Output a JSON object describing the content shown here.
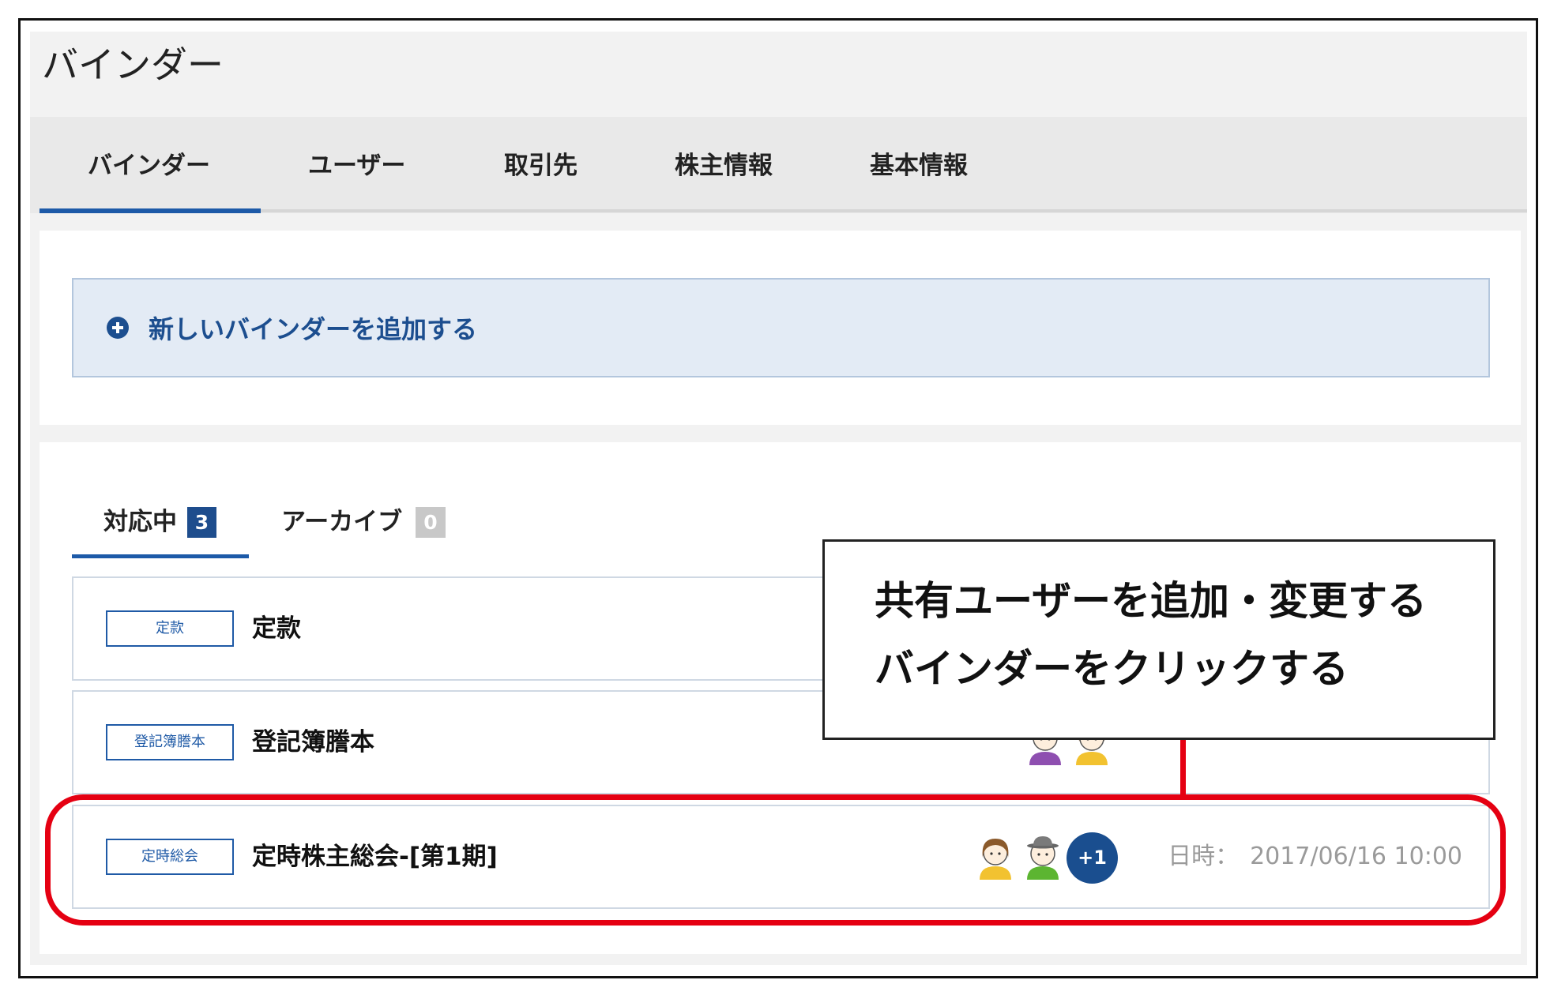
{
  "page": {
    "title": "バインダー"
  },
  "nav": {
    "tabs": [
      {
        "label": "バインダー",
        "active": true
      },
      {
        "label": "ユーザー",
        "active": false
      },
      {
        "label": "取引先",
        "active": false
      },
      {
        "label": "株主情報",
        "active": false
      },
      {
        "label": "基本情報",
        "active": false
      }
    ]
  },
  "add_binder": {
    "label": "新しいバインダーを追加する",
    "icon": "plus-circle-icon"
  },
  "binder_tabs": [
    {
      "label": "対応中",
      "count": "3",
      "active": true
    },
    {
      "label": "アーカイブ",
      "count": "0",
      "active": false
    }
  ],
  "binders": [
    {
      "tag": "定款",
      "title": "定款"
    },
    {
      "tag": "登記簿謄本",
      "title": "登記簿謄本",
      "users": [
        {
          "icon": "user-avatar-icon",
          "shirt_color": "#8e4fb0"
        },
        {
          "icon": "user-avatar-icon",
          "shirt_color": "#f2c230"
        }
      ]
    },
    {
      "tag": "定時総会",
      "title": "定時株主総会-[第1期]",
      "users": [
        {
          "icon": "woman-avatar-icon",
          "shirt_color": "#f2c230"
        },
        {
          "icon": "man-with-hat-avatar-icon",
          "shirt_color": "#5cb531"
        }
      ],
      "more_users": "+1",
      "date_label": "日時：",
      "date": "2017/06/16 10:00"
    }
  ],
  "callout": {
    "lines": [
      "共有ユーザーを追加・変更する",
      "バインダーをクリックする"
    ]
  },
  "colors": {
    "accent": "#1d5aa8",
    "link_text": "#1c4e8f",
    "badge_active": "#1e4d8d",
    "badge_inactive": "#c8c8c8",
    "highlight": "#e50012",
    "more_users_badge": "#1a4e8f"
  }
}
